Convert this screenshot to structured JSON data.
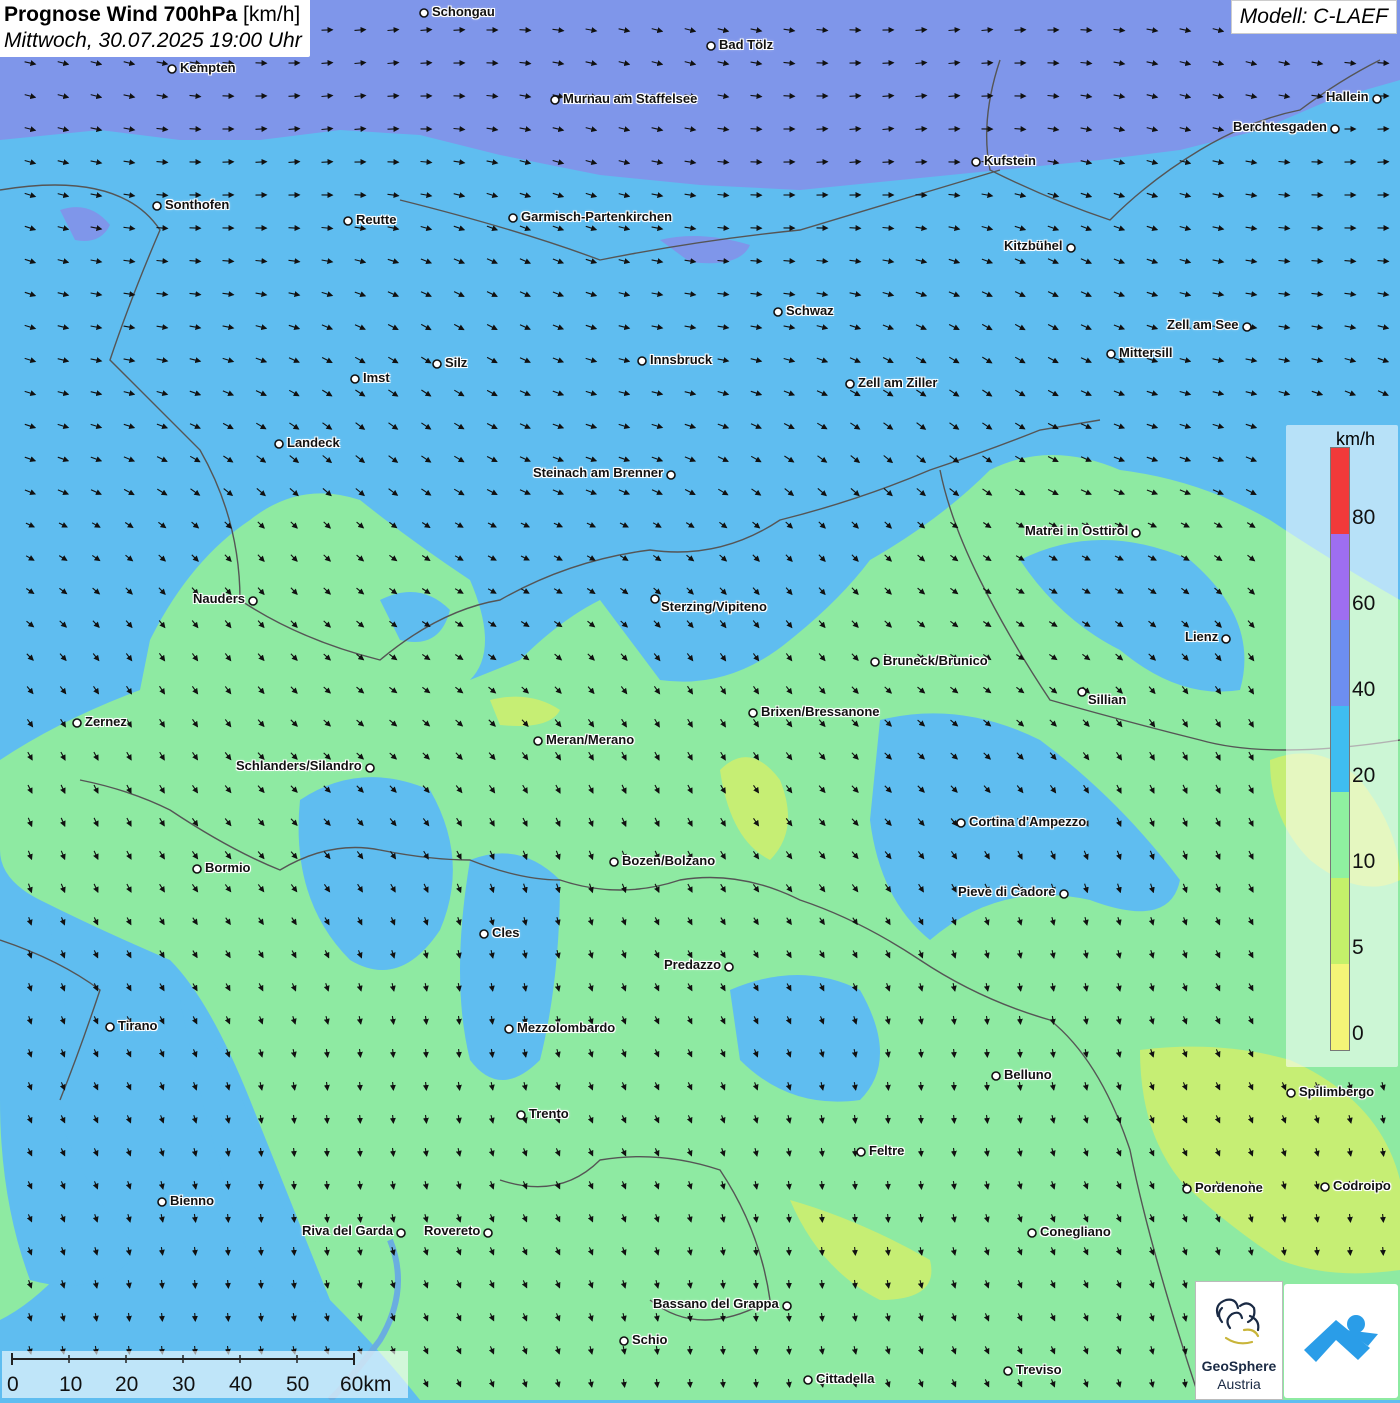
{
  "title": {
    "bold": "Prognose Wind 700hPa",
    "unit": " [km/h]",
    "datetime": "Mittwoch, 30.07.2025 19:00 Uhr"
  },
  "model": "Modell: C-LAEF",
  "legend": {
    "unit": "km/h",
    "ticks": [
      "80",
      "60",
      "40",
      "20",
      "10",
      "5",
      "0"
    ],
    "colors": [
      "#f23a3a",
      "#9e6ef0",
      "#6d8ef0",
      "#3fbdf0",
      "#8ff0a0",
      "#c4f06a",
      "#f5f577"
    ]
  },
  "scale": {
    "labels": [
      "0",
      "10",
      "20",
      "30",
      "40",
      "50",
      "60km"
    ]
  },
  "logo": {
    "line1": "GeoSphere",
    "line2": "Austria"
  },
  "icons": {
    "geosphere": "geosphere-logo-icon",
    "app": "weather-app-logo-icon"
  },
  "cities": [
    {
      "name": "Schongau"
    },
    {
      "name": "Bad Tölz"
    },
    {
      "name": "Kempten"
    },
    {
      "name": "Murnau am Staffelsee"
    },
    {
      "name": "Hallein"
    },
    {
      "name": "Berchtesgaden"
    },
    {
      "name": "Kufstein"
    },
    {
      "name": "Sonthofen"
    },
    {
      "name": "Reutte"
    },
    {
      "name": "Garmisch-Partenkirchen"
    },
    {
      "name": "Kitzbühel"
    },
    {
      "name": "Schwaz"
    },
    {
      "name": "Zell am See"
    },
    {
      "name": "Mittersill"
    },
    {
      "name": "Innsbruck"
    },
    {
      "name": "Silz"
    },
    {
      "name": "Imst"
    },
    {
      "name": "Zell am Ziller"
    },
    {
      "name": "Landeck"
    },
    {
      "name": "Steinach am Brenner"
    },
    {
      "name": "Matrei in Osttirol"
    },
    {
      "name": "Nauders"
    },
    {
      "name": "Sterzing/Vipiteno"
    },
    {
      "name": "Lienz"
    },
    {
      "name": "Bruneck/Brunico"
    },
    {
      "name": "Sillian"
    },
    {
      "name": "Brixen/Bressanone"
    },
    {
      "name": "Zernez"
    },
    {
      "name": "Meran/Merano"
    },
    {
      "name": "Schlanders/Silandro"
    },
    {
      "name": "Cortina d'Ampezzo"
    },
    {
      "name": "Bormio"
    },
    {
      "name": "Bozen/Bolzano"
    },
    {
      "name": "Pieve di Cadore"
    },
    {
      "name": "Cles"
    },
    {
      "name": "Predazzo"
    },
    {
      "name": "Tirano"
    },
    {
      "name": "Mezzolombardo"
    },
    {
      "name": "Belluno"
    },
    {
      "name": "Spilimbergo"
    },
    {
      "name": "Trento"
    },
    {
      "name": "Feltre"
    },
    {
      "name": "Pordenone"
    },
    {
      "name": "Codroipo"
    },
    {
      "name": "Bienno"
    },
    {
      "name": "Riva del Garda"
    },
    {
      "name": "Rovereto"
    },
    {
      "name": "Conegliano"
    },
    {
      "name": "Bassano del Grappa"
    },
    {
      "name": "Schio"
    },
    {
      "name": "Treviso"
    },
    {
      "name": "Cittadella"
    }
  ]
}
